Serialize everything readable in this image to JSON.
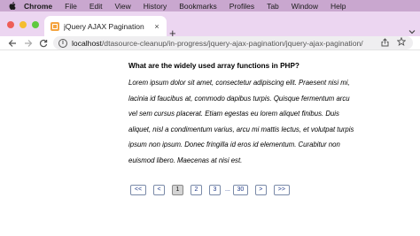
{
  "menubar": {
    "items": [
      "Chrome",
      "File",
      "Edit",
      "View",
      "History",
      "Bookmarks",
      "Profiles",
      "Tab",
      "Window",
      "Help"
    ]
  },
  "tab": {
    "title": "jQuery AJAX Pagination",
    "close": "×",
    "new_tab": "+"
  },
  "address": {
    "host": "localhost",
    "path": "/dtasource-cleanup/in-progress/jquery-ajax-pagination/jquery-ajax-pagination/"
  },
  "article": {
    "title": "What are the widely used array functions in PHP?",
    "lines": [
      "Lorem ipsum dolor sit amet, consectetur adipiscing elit. Praesent nisi mi,",
      "lacinia id faucibus at, commodo dapibus turpis. Quisque fermentum arcu",
      "vel sem cursus placerat. Etiam egestas eu lorem aliquet finibus. Duis",
      "aliquet, nisl a condimentum varius, arcu mi mattis lectus, et volutpat turpis",
      "ipsum non ipsum. Donec fringilla id eros id elementum. Curabitur non",
      "euismod libero. Maecenas at nisi est."
    ]
  },
  "pagination": {
    "first": "<<",
    "prev": "<",
    "pages": [
      "1",
      "2",
      "3"
    ],
    "ellipsis": "...",
    "last_page": "30",
    "next": ">",
    "last": ">>",
    "current": "1"
  },
  "colors": {
    "menubar": "#c9a7cf",
    "tabstrip": "#ecd6f1",
    "link": "#1f3a8a",
    "active_page_bg": "#d4d4d4"
  }
}
